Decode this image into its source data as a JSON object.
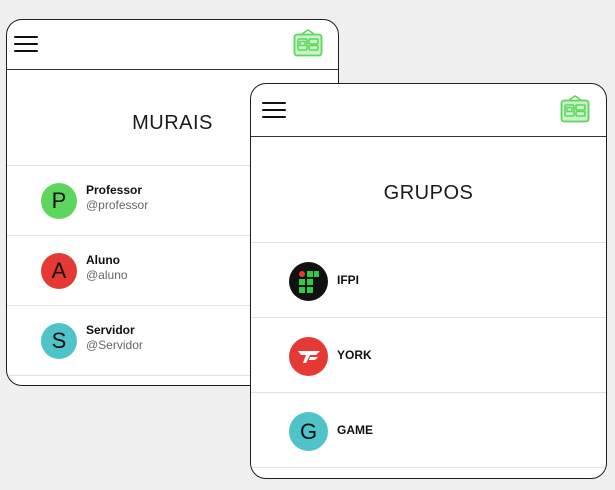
{
  "murais_card": {
    "title": "MURAIS",
    "users": [
      {
        "initial": "P",
        "name": "Professor",
        "handle": "@professor",
        "color": "#5cd65c"
      },
      {
        "initial": "A",
        "name": "Aluno",
        "handle": "@aluno",
        "color": "#e53935"
      },
      {
        "initial": "S",
        "name": "Servidor",
        "handle": "@Servidor",
        "color": "#4fc3c8"
      }
    ]
  },
  "grupos_card": {
    "title": "GRUPOS",
    "groups": [
      {
        "name": "IFPI",
        "icon": "ifpi-logo"
      },
      {
        "name": "YORK",
        "icon": "york-logo"
      },
      {
        "name": "GAME",
        "initial": "G",
        "color": "#4fc3c8"
      }
    ]
  },
  "colors": {
    "board_icon": "#5cd65c",
    "border": "#1e1e1e",
    "background": "#efefef"
  }
}
